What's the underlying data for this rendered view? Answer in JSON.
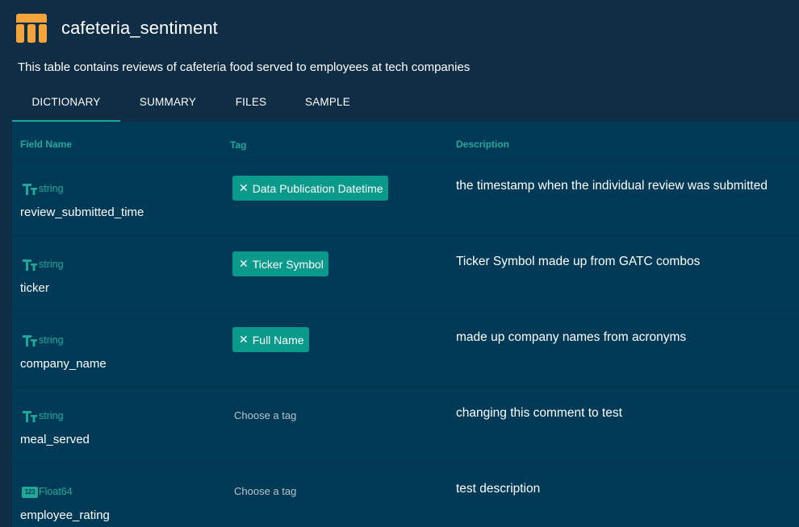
{
  "dataset": {
    "title": "cafeteria_sentiment",
    "description": "This table contains reviews of cafeteria food served to employees at tech companies",
    "icon": "table-icon",
    "icon_color": "#f5a33b"
  },
  "tabs": [
    {
      "label": "DICTIONARY",
      "active": true
    },
    {
      "label": "SUMMARY",
      "active": false
    },
    {
      "label": "FILES",
      "active": false
    },
    {
      "label": "SAMPLE",
      "active": false
    }
  ],
  "table": {
    "headers": {
      "field_name": "Field Name",
      "tag": "Tag",
      "description": "Description"
    },
    "rows": [
      {
        "type": "string",
        "type_icon": "text-type-icon",
        "field_name": "review_submitted_time",
        "tag": "Data Publication Datetime",
        "tag_placeholder": "",
        "description": "the timestamp when the individual review was submitted"
      },
      {
        "type": "string",
        "type_icon": "text-type-icon",
        "field_name": "ticker",
        "tag": "Ticker Symbol",
        "tag_placeholder": "",
        "description": "Ticker Symbol made up from GATC combos"
      },
      {
        "type": "string",
        "type_icon": "text-type-icon",
        "field_name": "company_name",
        "tag": "Full Name",
        "tag_placeholder": "",
        "description": "made up company names from acronyms"
      },
      {
        "type": "string",
        "type_icon": "text-type-icon",
        "field_name": "meal_served",
        "tag": "",
        "tag_placeholder": "Choose a tag",
        "description": "changing this comment to test"
      },
      {
        "type": "Float64",
        "type_icon": "numeric-type-icon",
        "type_icon_text": "123",
        "field_name": "employee_rating",
        "tag": "",
        "tag_placeholder": "Choose a tag",
        "description": "test description"
      }
    ]
  },
  "colors": {
    "background": "#0f2d44",
    "table_background": "#003a57",
    "accent": "#1fa898",
    "tag_chip": "#0a9a8c"
  }
}
